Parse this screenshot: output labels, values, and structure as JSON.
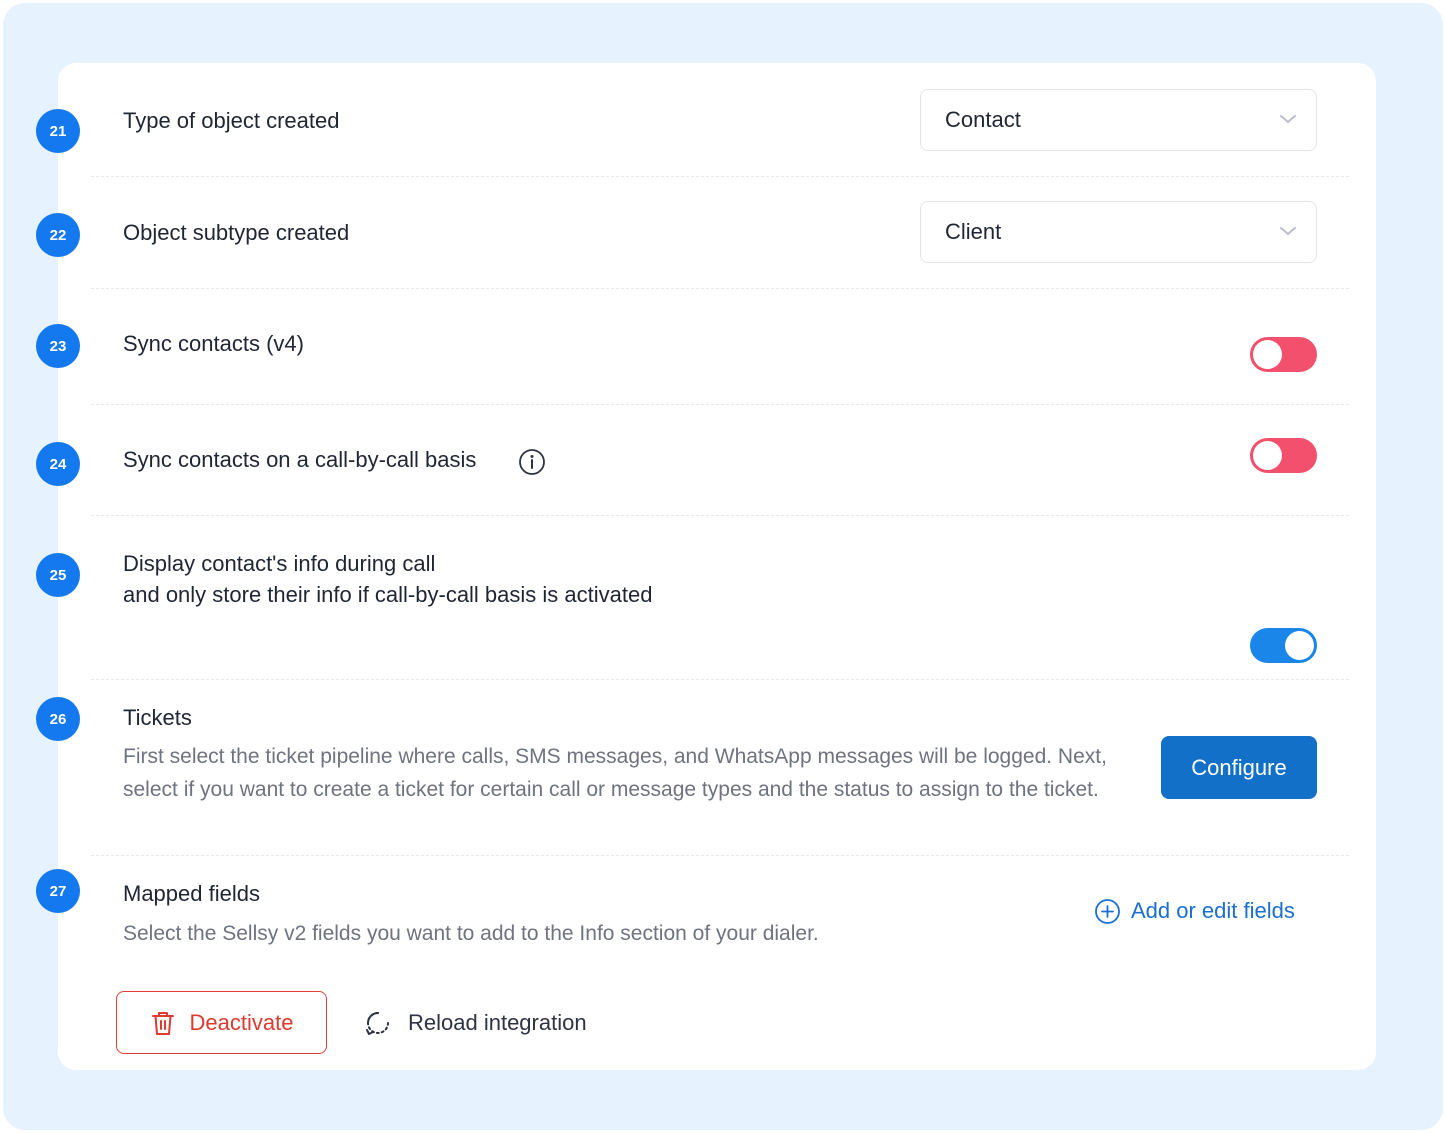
{
  "settings": [
    {
      "number": "21",
      "label": "Type of object created",
      "control": "select",
      "value": "Contact"
    },
    {
      "number": "22",
      "label": "Object subtype created",
      "control": "select",
      "value": "Client"
    },
    {
      "number": "23",
      "label": "Sync contacts (v4)",
      "control": "toggle",
      "enabled": false
    },
    {
      "number": "24",
      "label": "Sync contacts on a call-by-call basis",
      "control": "toggle",
      "enabled": false,
      "has_info_icon": true
    },
    {
      "number": "25",
      "label_line1": "Display contact's info during call",
      "label_line2": "and only store their info if call-by-call basis is activated",
      "control": "toggle",
      "enabled": true
    },
    {
      "number": "26",
      "title": "Tickets",
      "description": "First select the ticket pipeline where calls, SMS messages, and WhatsApp messages will be logged. Next, select if you want to create a ticket for certain call or message types and the status to assign to the ticket.",
      "button_label": "Configure"
    },
    {
      "number": "27",
      "title": "Mapped fields",
      "description": "Select the Sellsy v2 fields you want to add to the Info section of your dialer.",
      "link_label": "Add or edit fields"
    }
  ],
  "footer": {
    "deactivate_label": "Deactivate",
    "reload_label": "Reload integration"
  },
  "colors": {
    "page_bg": "#e6f2fd",
    "badge": "#1478ef",
    "toggle_off": "#f2506d",
    "toggle_on": "#1a86ea",
    "primary_button": "#1270c9",
    "link": "#1a6fd1",
    "danger": "#de3a2f"
  },
  "icons": {
    "select_chevron": "chevron-down-icon",
    "info": "info-icon",
    "add": "plus-circle-icon",
    "deactivate": "trash-icon",
    "reload": "reload-icon"
  }
}
